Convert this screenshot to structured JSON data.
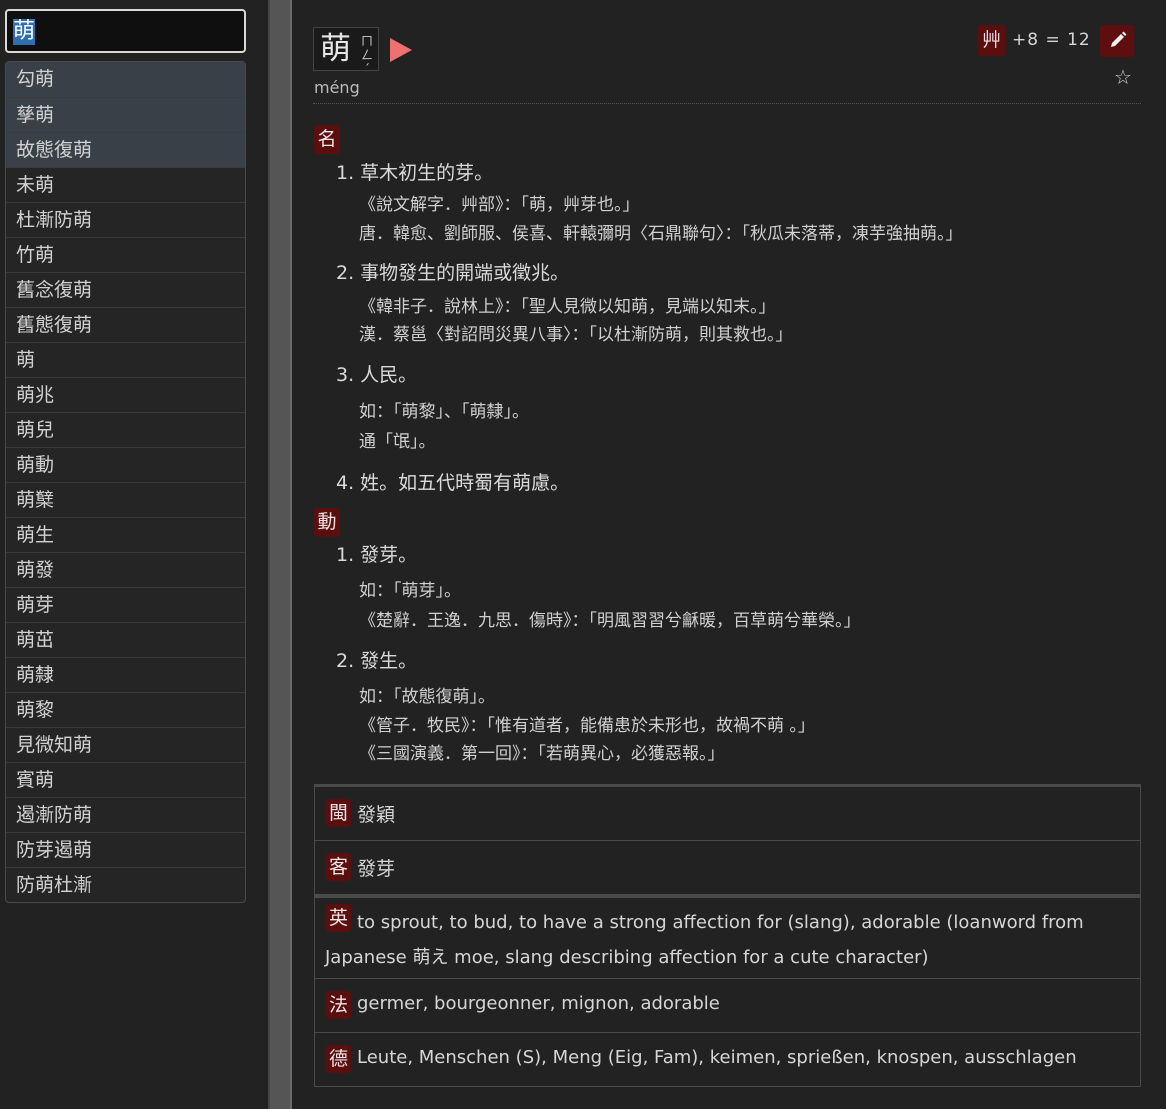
{
  "search": {
    "value": "萌"
  },
  "results": [
    {
      "label": "勾萌",
      "highlight": true
    },
    {
      "label": "孳萌",
      "highlight": true
    },
    {
      "label": "故態復萌",
      "highlight": true
    },
    {
      "label": "未萌"
    },
    {
      "label": "杜漸防萌"
    },
    {
      "label": "竹萌"
    },
    {
      "label": "舊念復萌"
    },
    {
      "label": "舊態復萌"
    },
    {
      "label": "萌"
    },
    {
      "label": "萌兆"
    },
    {
      "label": "萌兒"
    },
    {
      "label": "萌動"
    },
    {
      "label": "萌櫱"
    },
    {
      "label": "萌生"
    },
    {
      "label": "萌發"
    },
    {
      "label": "萌芽"
    },
    {
      "label": "萌茁"
    },
    {
      "label": "萌隸"
    },
    {
      "label": "萌黎"
    },
    {
      "label": "見微知萌"
    },
    {
      "label": "賓萌"
    },
    {
      "label": "遏漸防萌"
    },
    {
      "label": "防芽遏萌"
    },
    {
      "label": "防萌杜漸"
    }
  ],
  "entry": {
    "title": "萌",
    "bopomofo": "ㄇㄥˊ",
    "pinyin": "méng",
    "radical": "艸",
    "stroke_calc": "+8 = 12",
    "icons": {
      "play": "play-icon",
      "edit": "pencil-icon",
      "star": "star-icon"
    },
    "accent_color": "#5a0f0f",
    "sections": [
      {
        "pos": "名",
        "definitions": [
          {
            "text": "1. 草木初生的芽。",
            "quotes": [
              "《說文解字．艸部》：「萌，艸芽也。」",
              "唐．韓愈、劉師服、侯喜、軒轅彌明〈石鼎聯句〉：「秋瓜未落蒂，凍芋強抽萌。」"
            ]
          },
          {
            "text": "2. 事物發生的開端或徵兆。",
            "quotes": [
              "《韓非子．說林上》：「聖人見微以知萌，見端以知末。」",
              "漢．蔡邕〈對詔問災異八事〉：「以杜漸防萌，則其救也。」"
            ]
          },
          {
            "text": "3. 人民。",
            "quotes": [
              "如：「萌黎」、「萌隸」。",
              "通「氓」。"
            ]
          },
          {
            "text": "4. 姓。如五代時蜀有萌慮。",
            "quotes": []
          }
        ]
      },
      {
        "pos": "動",
        "definitions": [
          {
            "text": "1. 發芽。",
            "quotes": [
              "如：「萌芽」。",
              "《楚辭．王逸．九思．傷時》：「明風習習兮龢暖，百草萌兮華榮。」"
            ]
          },
          {
            "text": "2. 發生。",
            "quotes": [
              "如：「故態復萌」。",
              "《管子．牧民》：「惟有道者，能備患於未形也，故禍不萌 。」",
              "《三國演義．第一回》：「若萌異心，必獲惡報。」"
            ]
          }
        ]
      }
    ],
    "dialects": [
      {
        "badge": "閩",
        "text": "發穎"
      },
      {
        "badge": "客",
        "text": "發芽"
      }
    ],
    "translations": [
      {
        "badge": "英",
        "lines": [
          "to sprout, to bud, to have a strong affection for (slang), adorable (loanword from",
          "Japanese 萌え moe, slang describing affection for a cute character)"
        ]
      },
      {
        "badge": "法",
        "lines": [
          "germer, bourgeonner, mignon, adorable"
        ]
      },
      {
        "badge": "德",
        "lines": [
          "Leute, Menschen (S), Meng (Eig, Fam), keimen, sprießen, knospen, ausschlagen"
        ]
      }
    ]
  }
}
